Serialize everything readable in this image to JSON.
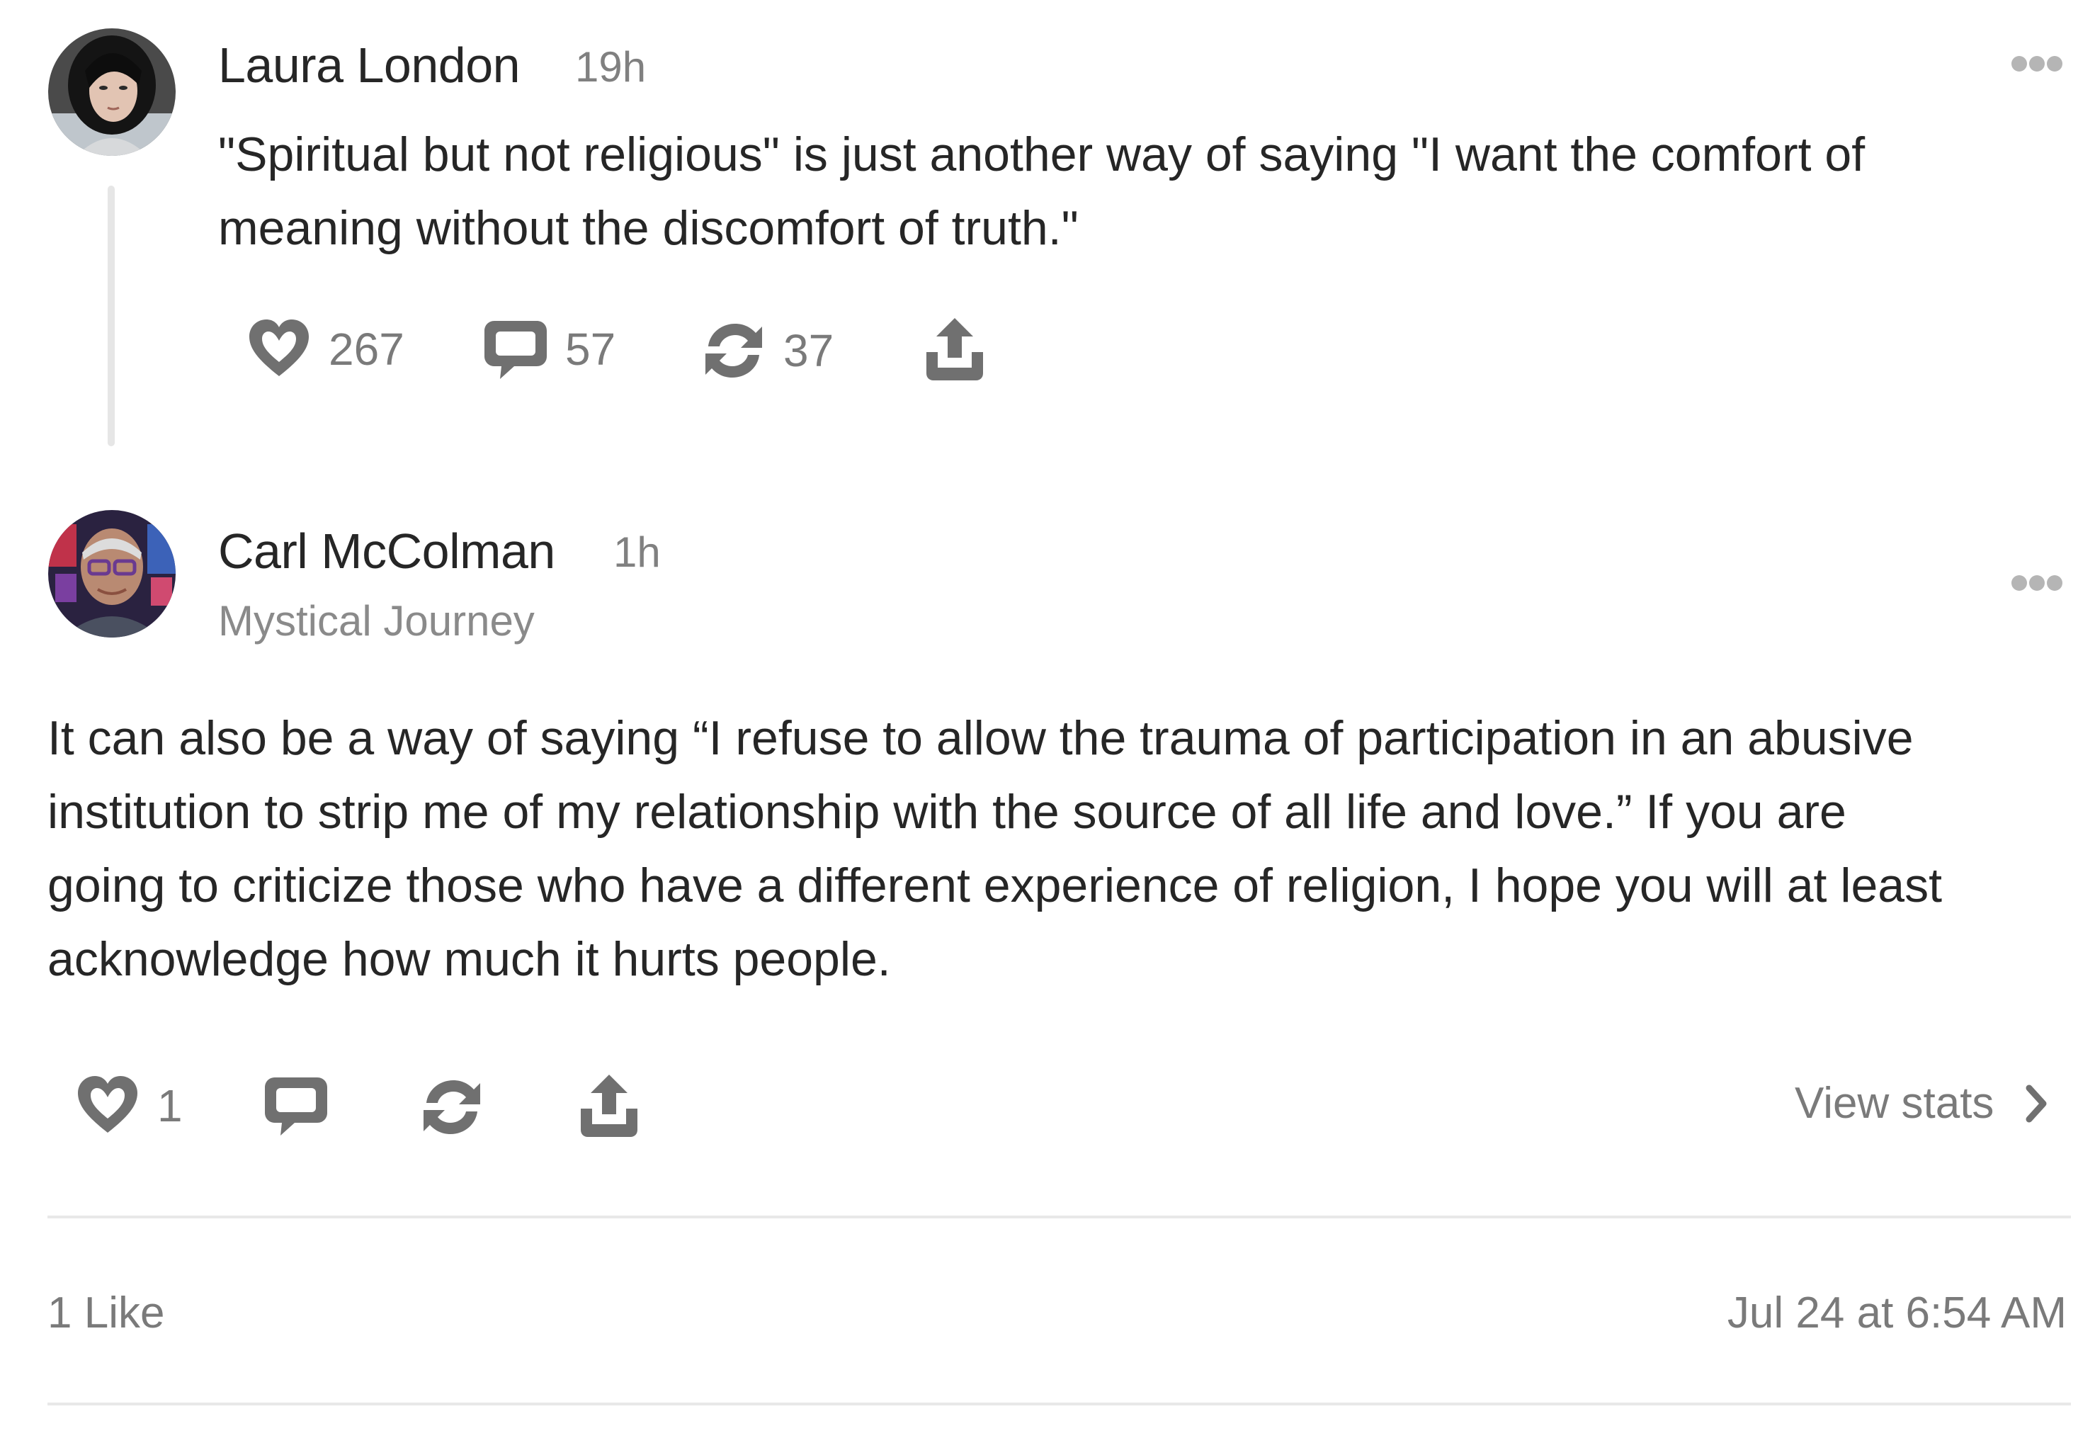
{
  "parent_post": {
    "author": "Laura London",
    "time": "19h",
    "text_line1": "\"Spiritual but not religious\" is just another way of saying \"I want the comfort of",
    "text_line2": "meaning without the discomfort of truth.\"",
    "likes": "267",
    "comments": "57",
    "restacks": "37"
  },
  "reply_post": {
    "author": "Carl McColman",
    "time": "1h",
    "publication": "Mystical Journey",
    "text_lines": [
      "It can also be a way of saying “I refuse to allow the trauma of participation in an abusive",
      "institution to strip me of my relationship with the source of all life and love.” If you are",
      "going to criticize those who have a different experience of religion, I hope you will at least",
      "acknowledge how much it hurts people."
    ],
    "likes": "1",
    "view_stats_label": "View stats"
  },
  "footer": {
    "likes_label": "1 Like",
    "date": "Jul 24 at 6:54 AM"
  },
  "icons": {
    "like": "heart-icon",
    "comment": "comment-icon",
    "restack": "restack-icon",
    "share": "share-icon",
    "more": "more-icon",
    "chevron": "chevron-right-icon"
  },
  "colors": {
    "icon_gray": "#707070",
    "text_dark": "#262626",
    "text_muted": "#7a7a7a"
  }
}
